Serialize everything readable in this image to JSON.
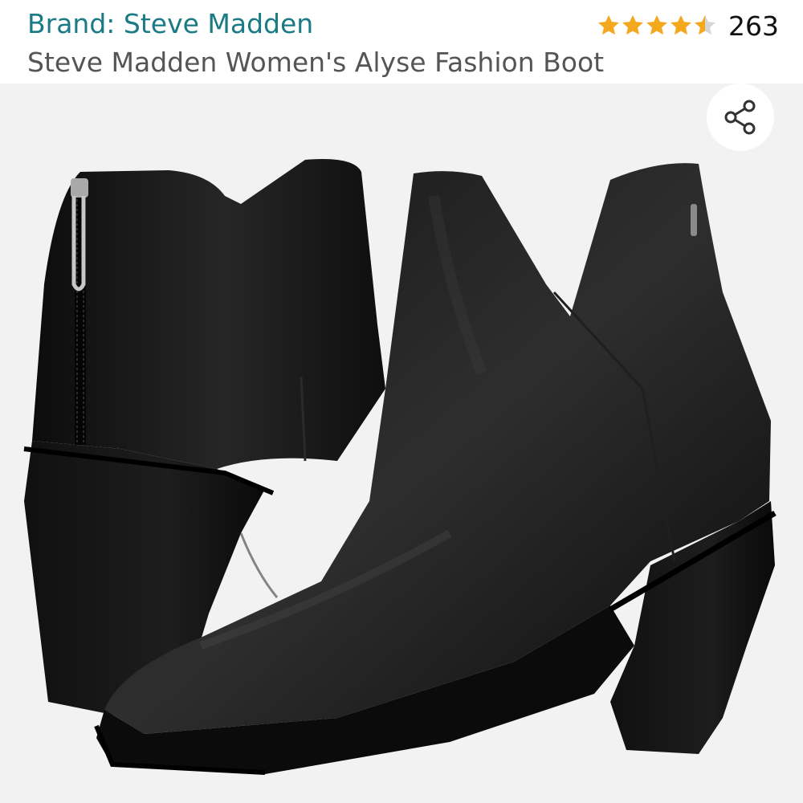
{
  "product": {
    "brand_label": "Brand: Steve Madden",
    "title": "Steve Madden Women's Alyse Fashion Boot",
    "rating_value": 4.5,
    "rating_max": 5,
    "review_count": "263"
  },
  "colors": {
    "brand_link": "#1a7a86",
    "star": "#f4a81d",
    "star_empty": "#d6d6d6",
    "title_text": "#555555",
    "gallery_bg": "#f2f2f2"
  },
  "icons": {
    "share": "share-icon",
    "star": "star-icon"
  }
}
